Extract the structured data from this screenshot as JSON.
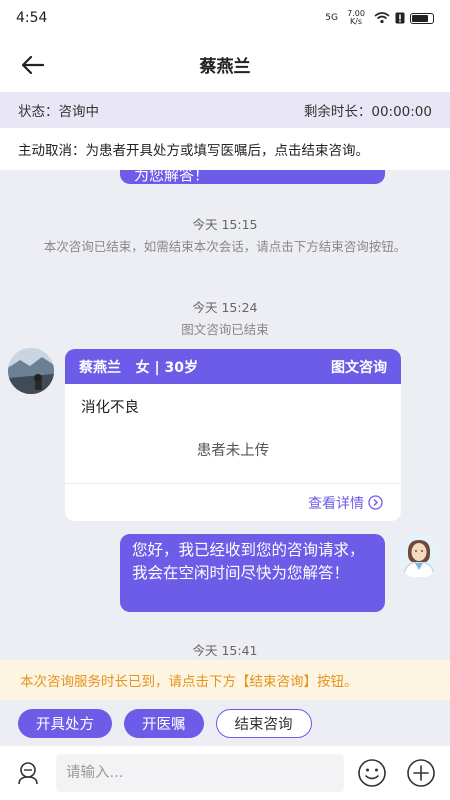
{
  "status_bar": {
    "time": "4:54",
    "network": "5G",
    "data_rate": "7.00 K/s"
  },
  "nav": {
    "title": "蔡燕兰"
  },
  "consult_status": {
    "label": "状态：咨询中",
    "remaining": "剩余时长：00:00:00"
  },
  "cancel_tip": "主动取消：为患者开具处方或填写医嘱后，点击结束咨询。",
  "chat": {
    "partial_bubble_text": "为您解答！",
    "time1": "今天 15:15",
    "system_msg1": "本次咨询已结束，如需结束本次会话，请点击下方结束咨询按钮。",
    "time2": "今天 15:24",
    "system_msg2": "图文咨询已结束",
    "card": {
      "patient_name": "蔡燕兰",
      "patient_info": "女 | 30岁",
      "type": "图文咨询",
      "complaint": "消化不良",
      "upload_status": "患者未上传",
      "detail_link": "查看详情"
    },
    "my_message": "您好，我已经收到您的咨询请求，我会在空闲时间尽快为您解答！",
    "time3": "今天 15:41"
  },
  "notice": "本次咨询服务时长已到，请点击下方【结束咨询】按钮。",
  "actions": {
    "prescribe": "开具处方",
    "advice": "开医嘱",
    "end": "结束咨询"
  },
  "input": {
    "placeholder": "请输入..."
  },
  "colors": {
    "accent": "#6d5ce7",
    "notice_text": "#e6931d",
    "notice_bg": "#fdf5e1"
  },
  "icons": [
    "back-arrow-icon",
    "emoji-icon",
    "voice-icon",
    "plus-icon",
    "chevron-right-circle-icon",
    "wifi-icon",
    "battery-icon"
  ]
}
